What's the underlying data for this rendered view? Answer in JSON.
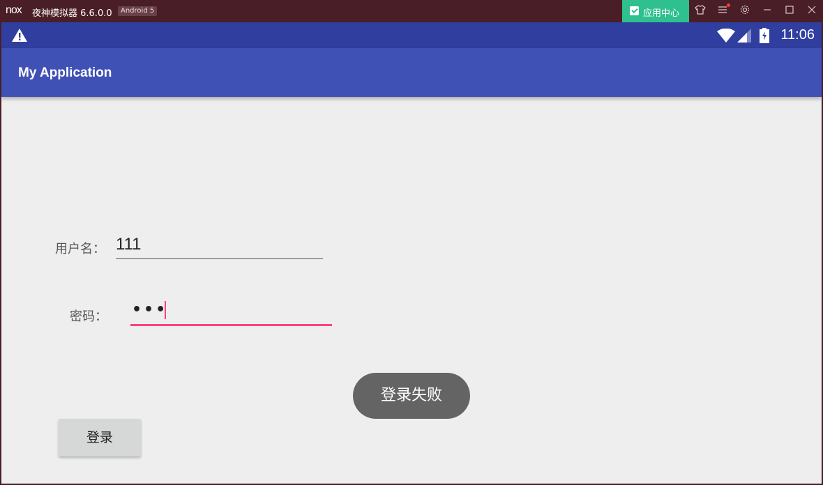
{
  "emulator": {
    "logo": "nox",
    "title": "夜神模拟器 6.6.0.0",
    "android_badge": "Android 5",
    "app_center_label": "应用中心",
    "icons": [
      "skin-icon",
      "menu-icon",
      "settings-icon",
      "minimize-icon",
      "maximize-icon",
      "close-icon"
    ]
  },
  "statusbar": {
    "time": "11:06",
    "icons": [
      "warning-icon",
      "wifi-icon",
      "signal-icon",
      "battery-icon"
    ]
  },
  "app": {
    "title": "My Application"
  },
  "form": {
    "username_label": "用户名：",
    "username_value": "111",
    "password_label": "密码：",
    "password_masked": "•••"
  },
  "toast": {
    "message": "登录失败"
  },
  "buttons": {
    "login_label": "登录"
  },
  "colors": {
    "status_bar": "#303f9f",
    "action_bar": "#3f51b5",
    "accent": "#ff4081",
    "app_center": "#2fc08f",
    "emulator_frame": "#4a1e26"
  }
}
